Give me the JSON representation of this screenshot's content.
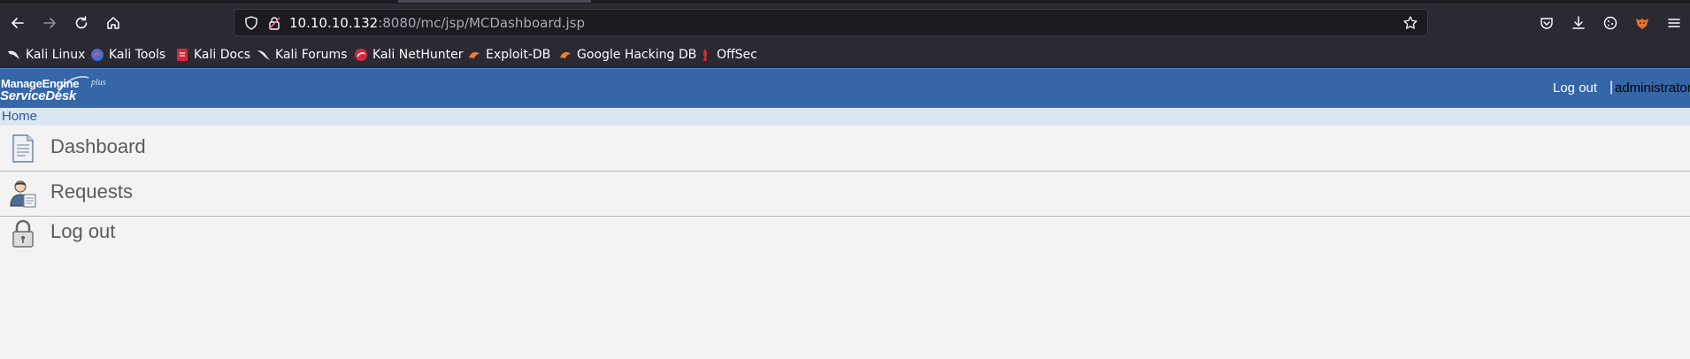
{
  "browser": {
    "url_host": "10.10.10.132",
    "url_rest": ":8080/mc/jsp/MCDashboard.jsp",
    "bookmarks": [
      {
        "label": "Kali Linux",
        "icon": "kali-dragon-icon"
      },
      {
        "label": "Kali Tools",
        "icon": "kali-tools-icon"
      },
      {
        "label": "Kali Docs",
        "icon": "kali-docs-icon"
      },
      {
        "label": "Kali Forums",
        "icon": "kali-forums-icon"
      },
      {
        "label": "Kali NetHunter",
        "icon": "kali-nethunter-icon"
      },
      {
        "label": "Exploit-DB",
        "icon": "exploit-db-icon"
      },
      {
        "label": "Google Hacking DB",
        "icon": "google-hacking-db-icon"
      },
      {
        "label": "OffSec",
        "icon": "offsec-icon"
      }
    ]
  },
  "app": {
    "logo": {
      "brand": "ManageEngine",
      "product": "ServiceDesk",
      "edition": "plus"
    },
    "header": {
      "logout_label": "Log out",
      "separator": "|",
      "username": "administrator"
    },
    "breadcrumb": {
      "home": "Home"
    },
    "menu": [
      {
        "label": "Dashboard",
        "icon": "document-icon"
      },
      {
        "label": "Requests",
        "icon": "requester-icon"
      },
      {
        "label": "Log out",
        "icon": "padlock-icon"
      }
    ]
  },
  "colors": {
    "header_blue": "#3466a8",
    "breadcrumb_bg": "#dbe6f3",
    "link_blue": "#2a5aa0",
    "browser_chrome": "#2b2a33"
  }
}
